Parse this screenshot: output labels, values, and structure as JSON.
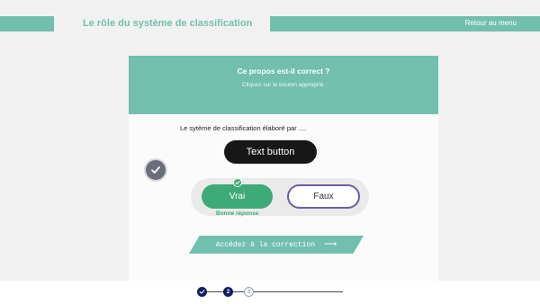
{
  "header": {
    "title": "Le rôle du système de classification",
    "back_link": "Retour au menu"
  },
  "card": {
    "title": "Ce propos est-il correct ?",
    "subtitle": "Cliquez sur le bouton approprié.",
    "statement": "Le sytème de classification élaboré par ....",
    "text_button": "Text button"
  },
  "answers": {
    "true_label": "Vrai",
    "false_label": "Faux",
    "selected": "Vrai",
    "feedback": "Bonne réponse"
  },
  "correction": {
    "label": "Accédez à la correction",
    "icon": "arrow-right-icon"
  },
  "progress": {
    "steps": [
      {
        "label": "",
        "state": "completed"
      },
      {
        "label": "2",
        "state": "current"
      },
      {
        "label": "3",
        "state": "upcoming"
      }
    ]
  },
  "colors": {
    "accent": "#72bfae",
    "success": "#3daa78",
    "outline": "#6f5ca3",
    "navy": "#0f1f62"
  }
}
